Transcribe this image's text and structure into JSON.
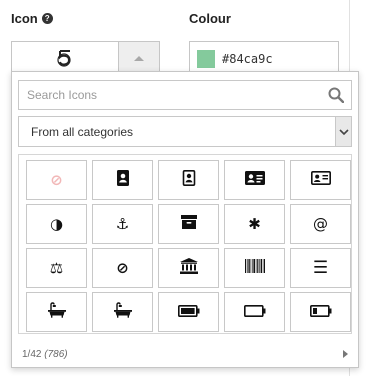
{
  "icon_field": {
    "label": "Icon",
    "help_glyph": "?",
    "selected_icon": "500px-icon"
  },
  "colour_field": {
    "label": "Colour",
    "value": "#84ca9c",
    "swatch": "#84ca9c"
  },
  "picker": {
    "search_placeholder": "Search Icons",
    "category": "From all categories",
    "icons": [
      {
        "name": "ban-icon",
        "glyph": "⊘",
        "color": "#f2b8b8"
      },
      {
        "name": "address-book-icon",
        "glyph": ""
      },
      {
        "name": "address-book-outline-icon",
        "glyph": ""
      },
      {
        "name": "address-card-icon",
        "glyph": ""
      },
      {
        "name": "address-card-outline-icon",
        "glyph": ""
      },
      {
        "name": "adjust-icon",
        "glyph": "◑"
      },
      {
        "name": "anchor-icon",
        "glyph": "⚓"
      },
      {
        "name": "archive-icon",
        "glyph": ""
      },
      {
        "name": "asterisk-icon",
        "glyph": "✱"
      },
      {
        "name": "at-icon",
        "glyph": "@"
      },
      {
        "name": "balance-scale-icon",
        "glyph": "⚖"
      },
      {
        "name": "ban-outline-icon",
        "glyph": "⊘"
      },
      {
        "name": "bank-icon",
        "glyph": ""
      },
      {
        "name": "barcode-icon",
        "glyph": ""
      },
      {
        "name": "bars-icon",
        "glyph": "☰"
      },
      {
        "name": "bath-icon",
        "glyph": ""
      },
      {
        "name": "bathtub-icon",
        "glyph": ""
      },
      {
        "name": "battery-full-icon",
        "glyph": ""
      },
      {
        "name": "battery-empty-icon",
        "glyph": ""
      },
      {
        "name": "battery-quarter-icon",
        "glyph": ""
      }
    ],
    "page_indicator": "1/42",
    "total_count": "(786)"
  }
}
